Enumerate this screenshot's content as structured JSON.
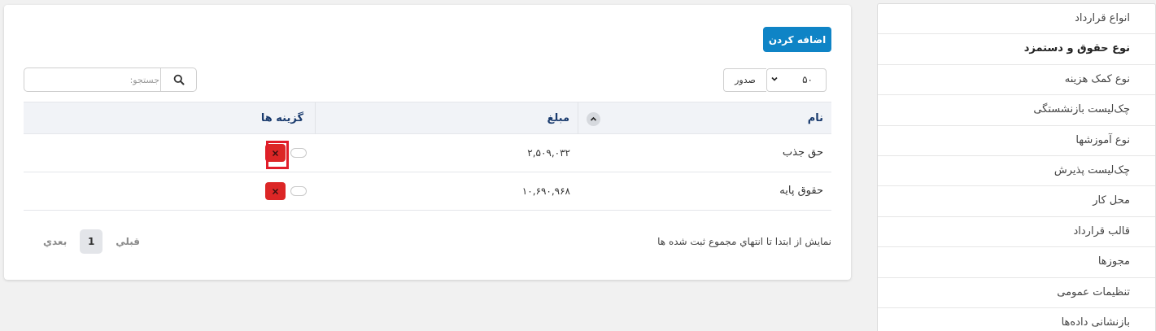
{
  "sidebar": {
    "items": [
      {
        "label": "انواع قرارداد"
      },
      {
        "label": "نوع حقوق و دستمزد"
      },
      {
        "label": "نوع کمک هزینه"
      },
      {
        "label": "چک‌لیست بازنشستگی"
      },
      {
        "label": "نوع آموزشها"
      },
      {
        "label": "چک‌لیست پذیرش"
      },
      {
        "label": "محل کار"
      },
      {
        "label": "قالب قرارداد"
      },
      {
        "label": "مجوزها"
      },
      {
        "label": "تنظیمات عمومی"
      },
      {
        "label": "بازنشانی داده‌ها"
      }
    ]
  },
  "toolbar": {
    "add_label": "اضافه کردن",
    "page_size": "۵۰",
    "export_label": "صدور",
    "search_placeholder": "جستجو:"
  },
  "table": {
    "headers": {
      "name": "نام",
      "amount": "مبلغ",
      "options": "گزینه ها"
    },
    "rows": [
      {
        "name": "حق جذب",
        "amount": "۲,۵۰۹,۰۳۲"
      },
      {
        "name": "حقوق پایه",
        "amount": "۱۰,۶۹۰,۹۶۸"
      }
    ]
  },
  "footer": {
    "info": "نمايش از ابتدا تا انتهاي مجموع ثبت شده ها",
    "prev_label": "قبلي",
    "current_page": "1",
    "next_label": "بعدي"
  },
  "colors": {
    "primary": "#0f84c6",
    "danger": "#dc2626",
    "highlight": "#e11d2a",
    "header_text": "#1a3b6e"
  }
}
